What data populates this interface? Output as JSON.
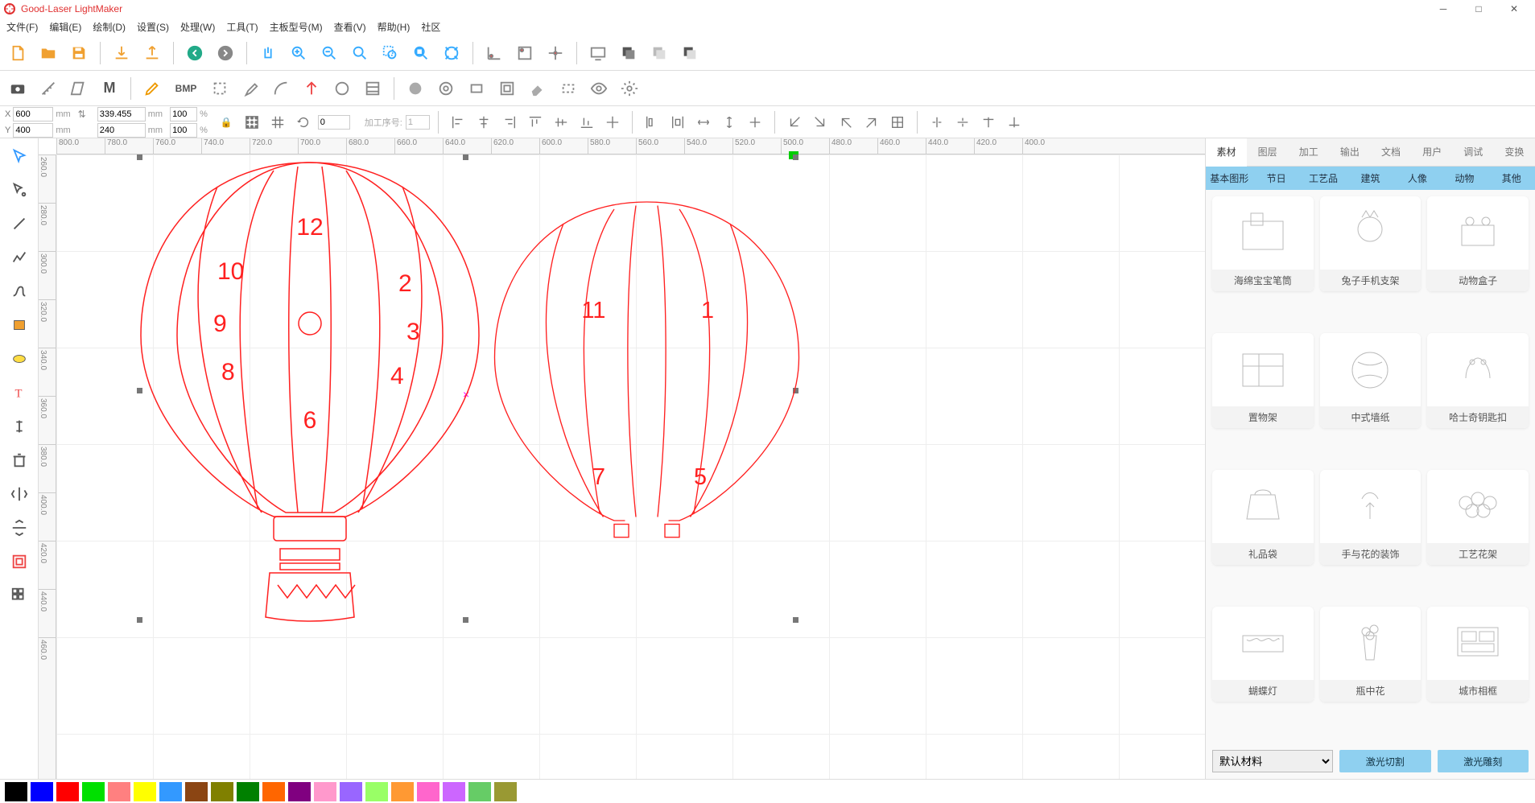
{
  "app": {
    "title": "Good-Laser LightMaker"
  },
  "menu": [
    "文件(F)",
    "编辑(E)",
    "绘制(D)",
    "设置(S)",
    "处理(W)",
    "工具(T)",
    "主板型号(M)",
    "查看(V)",
    "帮助(H)",
    "社区"
  ],
  "coords": {
    "x_label": "X",
    "x": "600",
    "x_unit": "mm",
    "y_label": "Y",
    "y": "400",
    "y_unit": "mm",
    "w": "339.455",
    "w_unit": "mm",
    "w_pct": "100",
    "pct": "%",
    "h": "240",
    "h_unit": "mm",
    "h_pct": "100",
    "rot": "0",
    "seq_label": "加工序号:",
    "seq": "1"
  },
  "ruler_h": [
    "800.0",
    "780.0",
    "760.0",
    "740.0",
    "720.0",
    "700.0",
    "680.0",
    "660.0",
    "640.0",
    "620.0",
    "600.0",
    "580.0",
    "560.0",
    "540.0",
    "520.0",
    "500.0",
    "480.0",
    "460.0",
    "440.0",
    "420.0",
    "400.0"
  ],
  "ruler_v": [
    "260.0",
    "280.0",
    "300.0",
    "320.0",
    "340.0",
    "360.0",
    "380.0",
    "400.0",
    "420.0",
    "440.0",
    "460.0"
  ],
  "design_numbers": [
    "12",
    "10",
    "2",
    "9",
    "3",
    "8",
    "4",
    "6",
    "11",
    "1",
    "7",
    "5"
  ],
  "rightTabs": [
    "素材",
    "图层",
    "加工",
    "输出",
    "文档",
    "用户",
    "调试",
    "变换"
  ],
  "categories": [
    "基本图形",
    "节日",
    "工艺品",
    "建筑",
    "人像",
    "动物",
    "其他"
  ],
  "gallery": [
    {
      "name": "海绵宝宝笔筒"
    },
    {
      "name": "兔子手机支架"
    },
    {
      "name": "动物盒子"
    },
    {
      "name": "置物架"
    },
    {
      "name": "中式墙纸"
    },
    {
      "name": "哈士奇钥匙扣"
    },
    {
      "name": "礼品袋"
    },
    {
      "name": "手与花的装饰"
    },
    {
      "name": "工艺花架"
    },
    {
      "name": "蝴蝶灯"
    },
    {
      "name": "瓶中花"
    },
    {
      "name": "城市相框"
    }
  ],
  "materialDefault": "默认材料",
  "actions": {
    "cut": "激光切割",
    "engrave": "激光雕刻"
  },
  "colors": [
    "#000000",
    "#0000ff",
    "#ff0000",
    "#00e000",
    "#ff8080",
    "#ffff00",
    "#3399ff",
    "#8b4513",
    "#808000",
    "#008000",
    "#ff6600",
    "#800080",
    "#ff99cc",
    "#9966ff",
    "#99ff66",
    "#ff9933",
    "#ff66cc",
    "#cc66ff",
    "#66cc66",
    "#999933"
  ],
  "bmp_label": "BMP",
  "m_label": "M"
}
